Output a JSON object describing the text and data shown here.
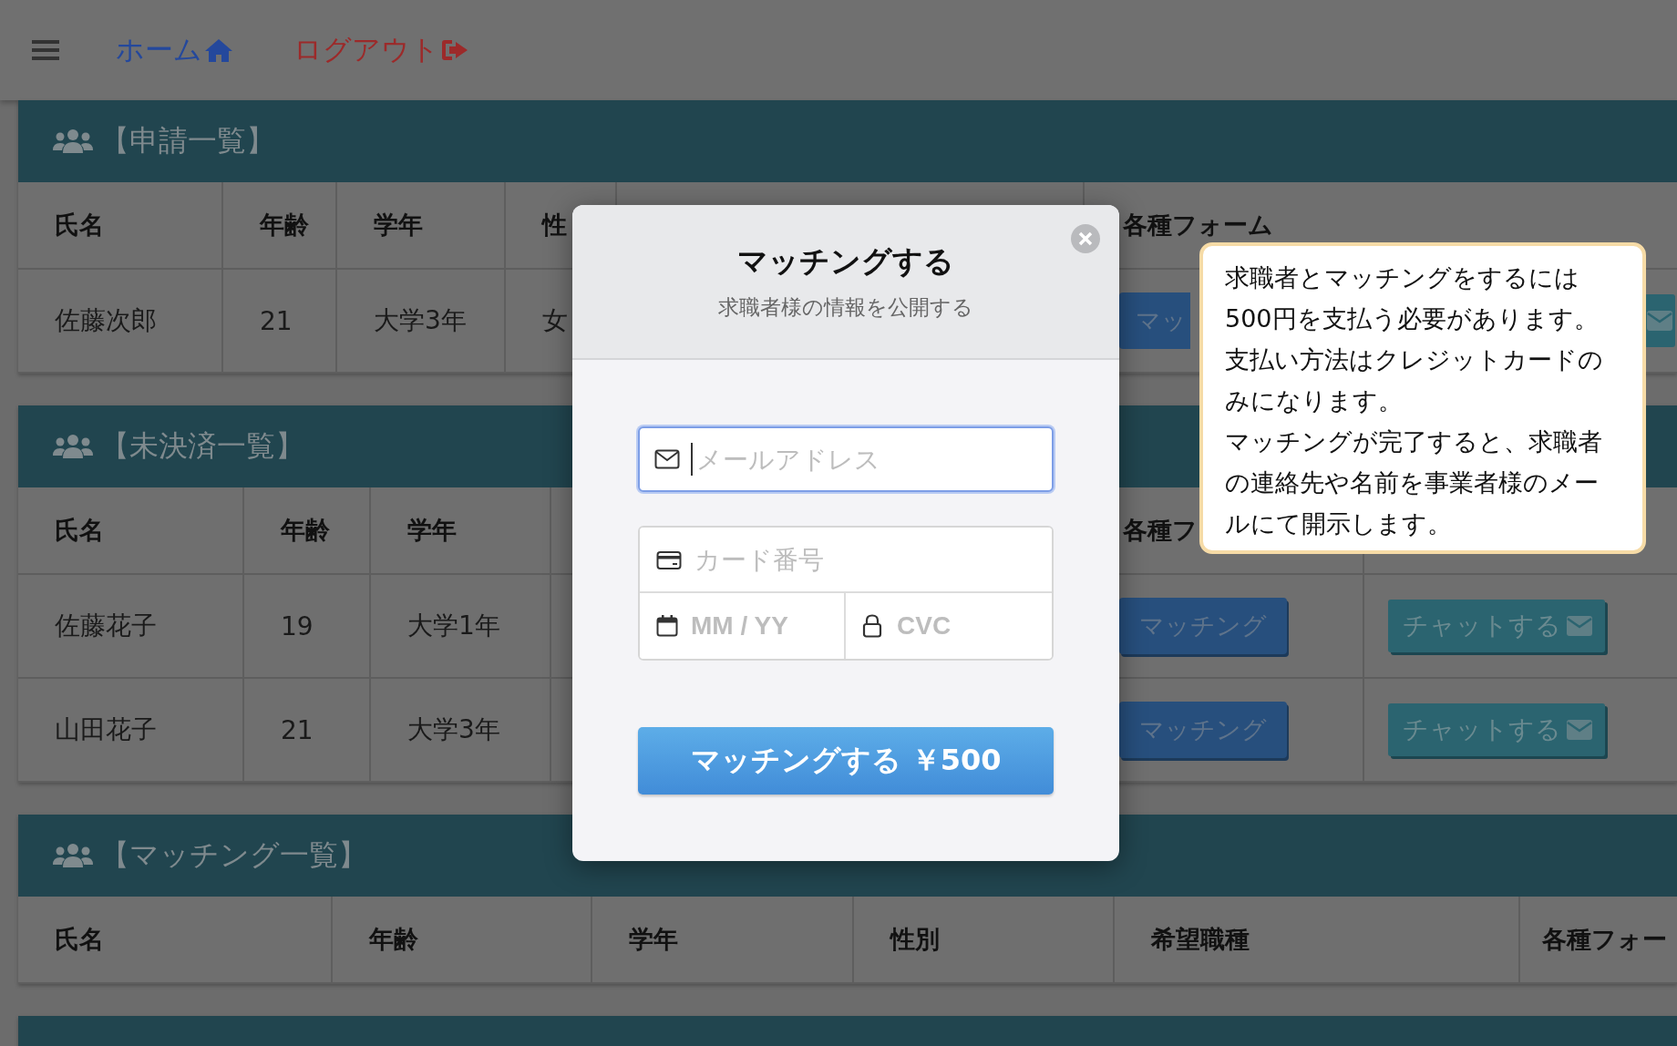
{
  "nav": {
    "home": "ホーム",
    "logout": "ログアウト"
  },
  "sections": [
    {
      "title": "【申請一覧】",
      "columns": [
        "氏名",
        "年齢",
        "学年",
        "性",
        "各種フォーム"
      ],
      "rows": [
        {
          "cells": [
            "佐藤次郎",
            "21",
            "大学3年",
            "女"
          ],
          "actions": [
            {
              "kind": "match",
              "label": "マッ"
            },
            {
              "kind": "chat"
            }
          ]
        }
      ]
    },
    {
      "title": "【未決済一覧】",
      "columns": [
        "氏名",
        "年齢",
        "学年",
        "各種フ"
      ],
      "rows": [
        {
          "cells": [
            "佐藤花子",
            "19",
            "大学1年"
          ],
          "actions": [
            {
              "kind": "match",
              "label": "マッチング"
            },
            {
              "kind": "chat",
              "label": "チャットする"
            }
          ]
        },
        {
          "cells": [
            "山田花子",
            "21",
            "大学3年"
          ],
          "actions": [
            {
              "kind": "match",
              "label": "マッチング"
            },
            {
              "kind": "chat",
              "label": "チャットする"
            }
          ]
        }
      ]
    },
    {
      "title": "【マッチング一覧】",
      "columns": [
        "氏名",
        "年齢",
        "学年",
        "性別",
        "希望職種",
        "各種フォー"
      ]
    }
  ],
  "modal": {
    "title": "マッチングする",
    "subtitle": "求職者様の情報を公開する",
    "email": {
      "placeholder": "メールアドレス",
      "focused": true
    },
    "card": {
      "placeholder": "カード番号"
    },
    "expiry": {
      "placeholder": "MM / YY"
    },
    "cvc": {
      "placeholder": "CVC"
    },
    "pay_button": "マッチングする ￥500"
  },
  "notice": {
    "paragraphs": [
      "求職者とマッチングをするには500円を支払う必要があります。支払い方法はクレジットカードのみになります。",
      "マッチングが完了すると、求職者の連絡先や名前を事業者様のメールにて開示します。"
    ]
  }
}
